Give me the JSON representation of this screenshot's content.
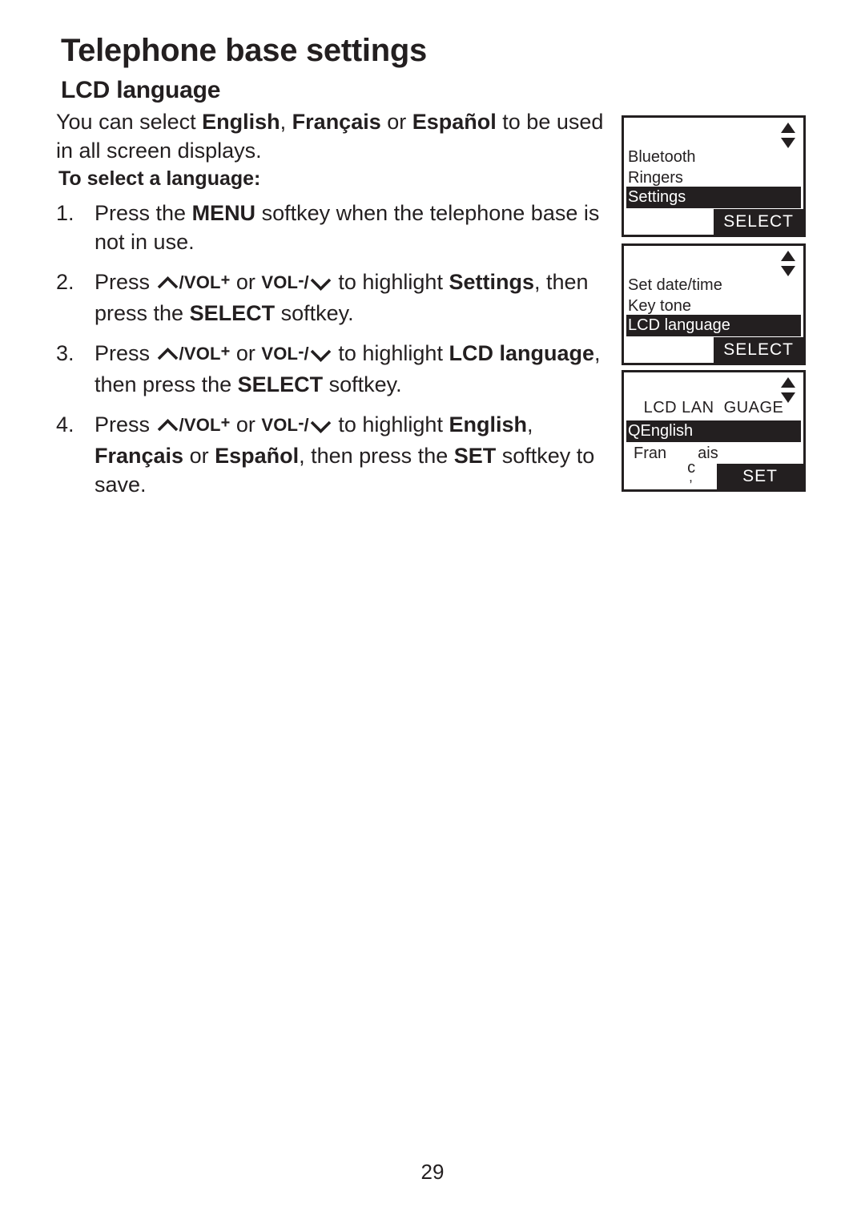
{
  "document": {
    "chapter_title": "Telephone base settings",
    "section_title": "LCD language",
    "page_number": "29"
  },
  "intro": {
    "prefix": "You can select ",
    "lang_1": "English",
    "sep_1": ", ",
    "lang_2": "Français",
    "sep_2": " or ",
    "lang_3": "Español",
    "suffix": " to be used in all screen displays."
  },
  "sub_head": "To select a language:",
  "steps": [
    {
      "number": "1.",
      "parts": [
        {
          "text": "Press the ",
          "bold": false
        },
        {
          "text": "MENU",
          "bold": true
        },
        {
          "text": " softkey when the telephone base is not in use.",
          "bold": false
        }
      ]
    },
    {
      "number": "2.",
      "parts": [
        {
          "text": "Press ",
          "bold": false
        },
        {
          "text": "[up-chevron]/VOL+",
          "bold": true
        },
        {
          "text": " or ",
          "bold": false
        },
        {
          "text": "VOL-/[down-chevron]",
          "bold": true
        },
        {
          "text": " to highlight ",
          "bold": false
        },
        {
          "text": "Settings",
          "bold": true
        },
        {
          "text": ", then press the ",
          "bold": false
        },
        {
          "text": "SELECT",
          "bold": true
        },
        {
          "text": " softkey.",
          "bold": false
        }
      ]
    },
    {
      "number": "3.",
      "parts": [
        {
          "text": "Press ",
          "bold": false
        },
        {
          "text": "[up-chevron]/VOL+",
          "bold": true
        },
        {
          "text": " or ",
          "bold": false
        },
        {
          "text": "VOL-/[down-chevron]",
          "bold": true
        },
        {
          "text": " to highlight ",
          "bold": false
        },
        {
          "text": "LCD language",
          "bold": true
        },
        {
          "text": ", then press the ",
          "bold": false
        },
        {
          "text": "SELECT",
          "bold": true
        },
        {
          "text": " softkey.",
          "bold": false
        }
      ]
    },
    {
      "number": "4.",
      "parts": [
        {
          "text": "Press ",
          "bold": false
        },
        {
          "text": "[up-chevron]/VOL+",
          "bold": true
        },
        {
          "text": " or ",
          "bold": false
        },
        {
          "text": "VOL-/[down-chevron]",
          "bold": true
        },
        {
          "text": " to highlight ",
          "bold": false
        },
        {
          "text": "English",
          "bold": true
        },
        {
          "text": ", ",
          "bold": false
        },
        {
          "text": "Français",
          "bold": true
        },
        {
          "text": " or ",
          "bold": false
        },
        {
          "text": "Español",
          "bold": true
        },
        {
          "text": ", then press the ",
          "bold": false
        },
        {
          "text": "SET",
          "bold": true
        },
        {
          "text": " softkey to save.",
          "bold": false
        }
      ]
    }
  ],
  "step_text": {
    "s1_a": "Press the ",
    "s1_menu": "MENU",
    "s1_b": " softkey when the telephone base is not in use.",
    "press": "Press ",
    "vol_word": "VOL",
    "vol_plus": "+",
    "vol_minus": "-",
    "slash": "/",
    "or": " or ",
    "to_highlight": " to highlight ",
    "s2_target": "Settings",
    "s2_tail_a": ", then press the ",
    "s2_tail_key": "SELECT",
    "s2_tail_b": " softkey.",
    "s3_target": "LCD language",
    "s3_tail_a": ", then press the ",
    "s3_tail_key": "SELECT",
    "s3_tail_b": " softkey.",
    "s4_t1": "English",
    "s4_comma": ", ",
    "s4_t2": "Français",
    "s4_or": " or ",
    "s4_t3": "Español",
    "s4_tail_a": ", then press the ",
    "s4_tail_key": "SET",
    "s4_tail_b": " softkey to save."
  },
  "screens": [
    {
      "id": "menu-list",
      "items": [
        "Bluetooth",
        "Ringers"
      ],
      "highlighted": "Settings",
      "softkey": "SELECT",
      "scroll_icon": "up-down-arrows-icon"
    },
    {
      "id": "settings-list",
      "items": [
        "Set date/time",
        "Key tone"
      ],
      "highlighted": "LCD language",
      "softkey": "SELECT",
      "scroll_icon": "up-down-arrows-icon"
    },
    {
      "id": "lcd-language-list",
      "title": "LCD LAN  GUAGE",
      "highlighted": "QEnglish",
      "item_fr_a": "Fran",
      "item_fr_cedilla": "c",
      "item_fr_tail": "ais",
      "softkey": "SET",
      "scroll_icon": "up-down-arrows-icon"
    }
  ],
  "colors": {
    "ink": "#231f20",
    "paper": "#ffffff"
  }
}
